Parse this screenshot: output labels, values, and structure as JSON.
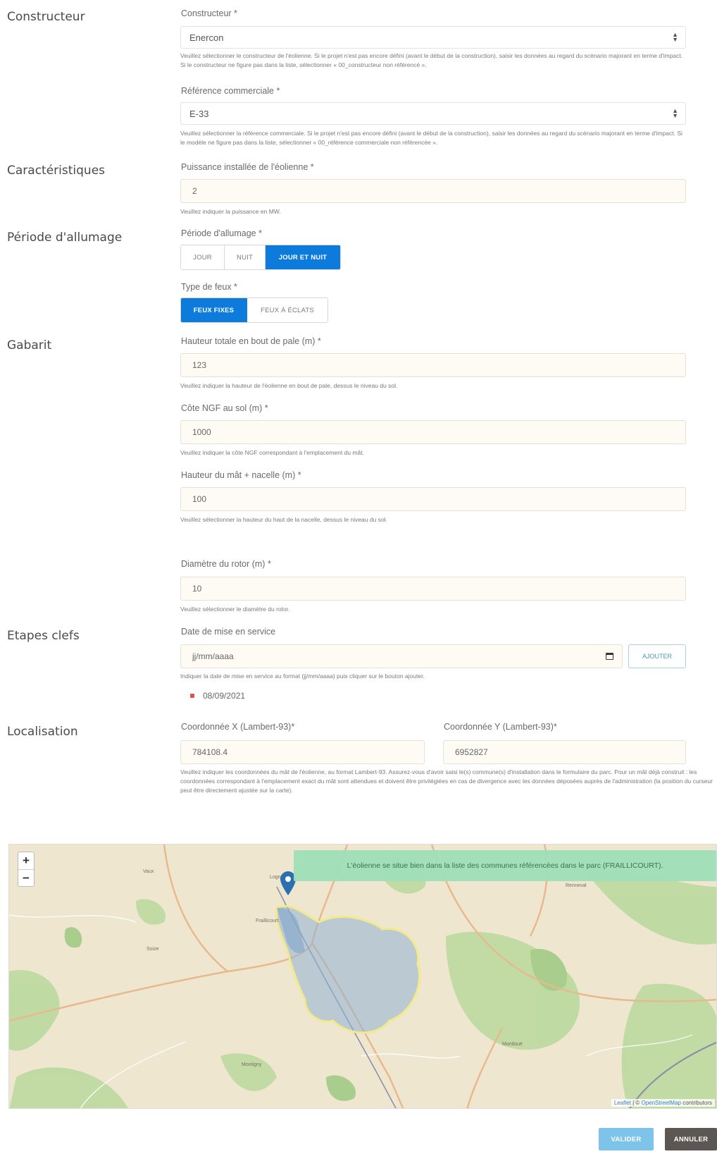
{
  "sections": {
    "constructeur": "Constructeur",
    "caracteristiques": "Caractéristiques",
    "periode": "Période d'allumage",
    "gabarit": "Gabarit",
    "etapes": "Etapes clefs",
    "localisation": "Localisation"
  },
  "constructeur": {
    "label": "Constructeur *",
    "value": "Enercon",
    "help": "Veuillez sélectionner le constructeur de l'éolienne. Si le projet n'est pas encore défini (avant le début de la construction), saisir les données au regard du scénario majorant en terme d'impact. Si le constructeur ne figure pas dans la liste, sélectionner « 00_constructeur non référencé »."
  },
  "reference": {
    "label": "Référence commerciale *",
    "value": "E-33",
    "help": "Veuillez sélectionner la référence commerciale. Si le projet n'est pas encore défini (avant le début de la construction), saisir les données au regard du scénario majorant en terme d'impact. Si le modèle ne figure pas dans la liste, sélectionner « 00_référence commerciale non référencée »."
  },
  "puissance": {
    "label": "Puissance installée de l'éolienne *",
    "value": "2",
    "help": "Veuillez indiquer la puissance en MW."
  },
  "allumage": {
    "label": "Période d'allumage *",
    "options": [
      "JOUR",
      "NUIT",
      "JOUR ET NUIT"
    ],
    "selected": "JOUR ET NUIT"
  },
  "feux": {
    "label": "Type de feux *",
    "options": [
      "FEUX FIXES",
      "FEUX À ÉCLATS"
    ],
    "selected": "FEUX FIXES"
  },
  "hauteur_totale": {
    "label": "Hauteur totale en bout de pale (m) *",
    "value": "123",
    "help": "Veuillez indiquer la hauteur de l'éolienne en bout de pale, dessus le niveau du sol."
  },
  "cote_ngf": {
    "label": "Côte NGF au sol (m) *",
    "value": "1000",
    "help": "Veuillez indiquer la côte NGF correspondant à l'emplacement du mât."
  },
  "hauteur_mat": {
    "label": "Hauteur du mât + nacelle (m) *",
    "value": "100",
    "help": "Veuillez sélectionner la hauteur du haut de la nacelle, dessus le niveau du sol."
  },
  "diametre": {
    "label": "Diamètre du rotor (m) *",
    "value": "10",
    "help": "Veuillez sélectionner le diamètre du rotor."
  },
  "date_service": {
    "label": "Date de mise en service",
    "placeholder": "jj/mm/aaaa",
    "add_label": "AJOUTER",
    "help": "Indiquer la date de mise en service au format (jj/mm/aaaa) puis cliquer sur le bouton ajouter.",
    "dates": [
      "08/09/2021"
    ]
  },
  "coord_x": {
    "label": "Coordonnée X (Lambert-93)*",
    "value": "784108.4"
  },
  "coord_y": {
    "label": "Coordonnée Y (Lambert-93)*",
    "value": "6952827"
  },
  "coord_help": "Veuillez indiquer les coordonnées du mât de l'éolienne, au format Lambert-93. Assurez-vous d'avoir saisi le(s) commune(s) d'installation dans le formulaire du parc. Pour un mât déjà construit : les coordonnées correspondant à l'emplacement exact du mât sont attendues et doivent être privilégiées en cas de divergence avec les données déposées auprès de l'administration (la position du curseur peut être directement ajustée sur la carte).",
  "map": {
    "banner": "L'éolienne se situe bien dans la liste des communes référencées dans le parc (FRAILLICOURT).",
    "zoom_in": "+",
    "zoom_out": "−",
    "attribution_leaflet": "Leaflet",
    "attribution_sep": " | © ",
    "attribution_osm": "OpenStreetMap",
    "attribution_tail": " contributors"
  },
  "footer": {
    "valider": "VALIDER",
    "annuler": "ANNULER"
  },
  "colors": {
    "accent": "#0d7bdb",
    "valider_bg": "#7ec4ea",
    "annuler_bg": "#5c5752"
  }
}
